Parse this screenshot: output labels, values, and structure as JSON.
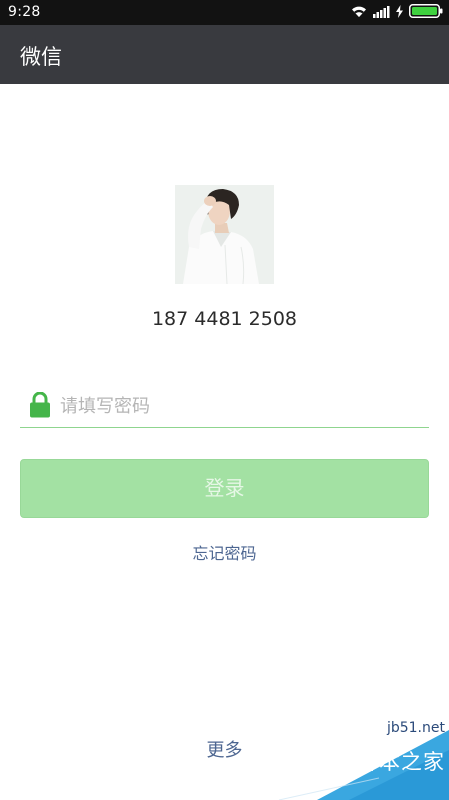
{
  "status_bar": {
    "time": "9:28",
    "icons": [
      "wifi-icon",
      "signal-icon",
      "charging-icon",
      "battery-icon"
    ]
  },
  "title_bar": {
    "title": "微信"
  },
  "account": {
    "phone": "187 4481 2508",
    "avatar": "avatar-photo"
  },
  "password": {
    "placeholder": "请填写密码",
    "value": "",
    "icon": "lock-icon"
  },
  "login_button": {
    "label": "登录"
  },
  "links": {
    "forgot_password": "忘记密码",
    "more": "更多"
  },
  "watermark": {
    "url": "jb51.net",
    "name": "脚本之家"
  },
  "colors": {
    "status_bar": "#121212",
    "title_bar": "#393a3f",
    "accent_green": "#44b549",
    "button_disabled": "#a3e1a3",
    "link": "#4d6691"
  }
}
